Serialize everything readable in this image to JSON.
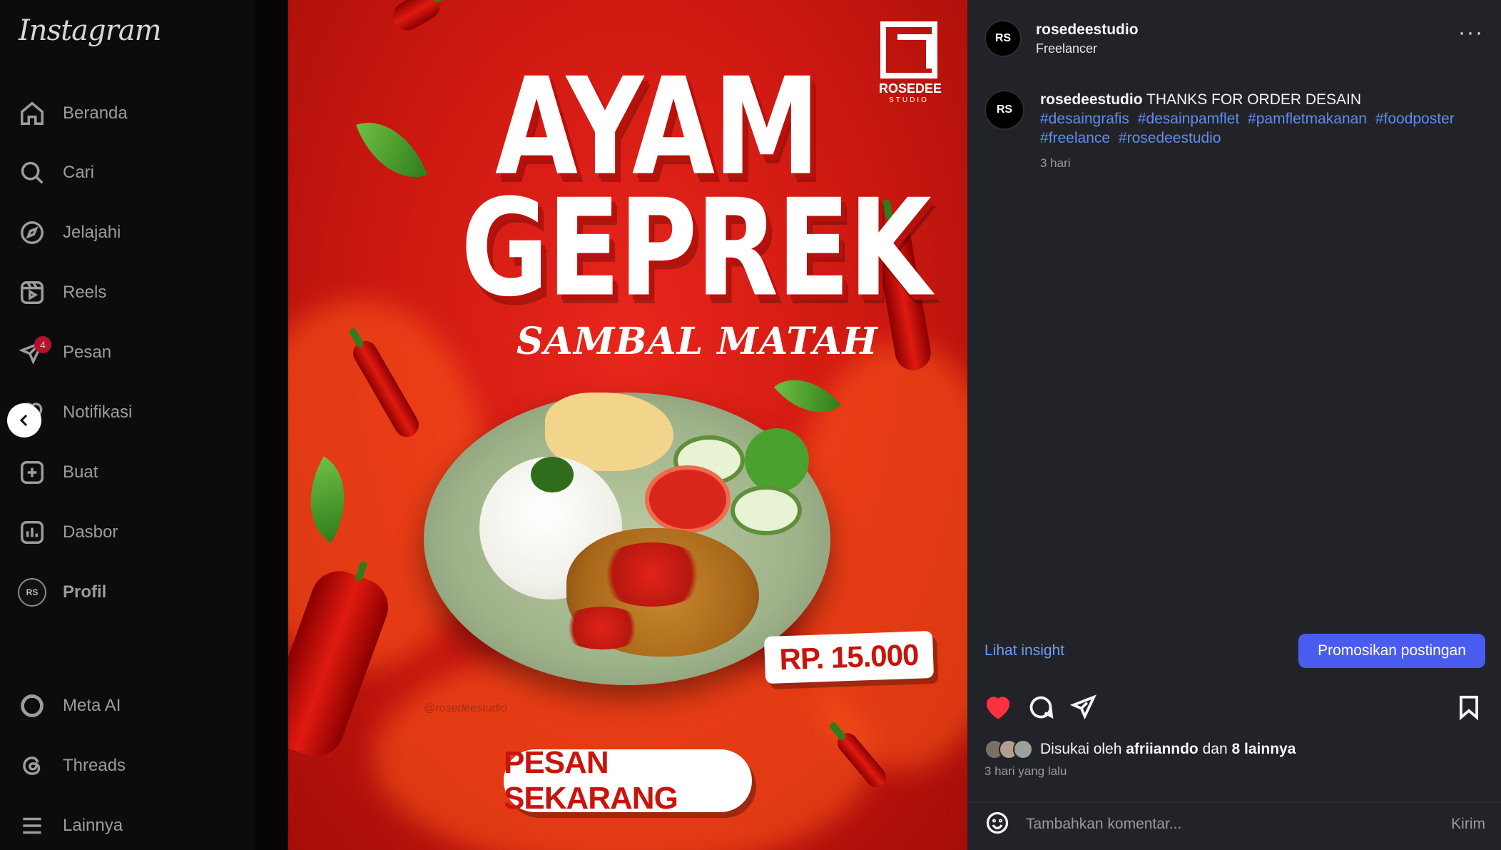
{
  "app": {
    "logo_text": "Instagram"
  },
  "sidebar": {
    "items": [
      {
        "label": "Beranda",
        "icon": "home-icon"
      },
      {
        "label": "Cari",
        "icon": "search-icon"
      },
      {
        "label": "Jelajahi",
        "icon": "compass-icon"
      },
      {
        "label": "Reels",
        "icon": "reels-icon"
      },
      {
        "label": "Pesan",
        "icon": "messenger-icon",
        "badge": "4"
      },
      {
        "label": "Notifikasi",
        "icon": "heart-icon"
      },
      {
        "label": "Buat",
        "icon": "plus-square-icon"
      },
      {
        "label": "Dasbor",
        "icon": "dashboard-icon"
      },
      {
        "label": "Profil",
        "icon": "profile-avatar-icon"
      }
    ],
    "bottom_items": [
      {
        "label": "Meta AI",
        "icon": "meta-ai-icon"
      },
      {
        "label": "Threads",
        "icon": "threads-icon"
      },
      {
        "label": "Lainnya",
        "icon": "hamburger-menu-icon"
      }
    ]
  },
  "poster": {
    "title_line1": "AYAM",
    "title_line2": "GEPREK",
    "subtitle": "SAMBAL MATAH",
    "brand_name": "ROSEDEE",
    "brand_sub": "STUDIO",
    "price": "RP. 15.000",
    "cta": "PESAN SEKARANG",
    "watermark": "@rosedeestudio",
    "colors": {
      "background": "#d11a12",
      "accent": "#c8140c"
    }
  },
  "post": {
    "username": "rosedeestudio",
    "subline": "Freelancer",
    "caption_text": "THANKS FOR ORDER DESAIN",
    "hashtags": [
      "#desaingrafis",
      "#desainpamflet",
      "#pamfletmakanan",
      "#foodposter",
      "#freelance",
      "#rosedeestudio"
    ],
    "caption_time": "3 hari",
    "insight_label": "Lihat insight",
    "promote_label": "Promosikan postingan",
    "likes_prefix": "Disukai oleh",
    "likes_user": "afriianndo",
    "likes_mid": "dan",
    "likes_others": "8 lainnya",
    "time_ago": "3 hari yang lalu",
    "comment_placeholder": "Tambahkan komentar...",
    "send_label": "Kirim",
    "colors": {
      "like": "#ff3040",
      "link": "#6e9cf0",
      "button": "#4a5cf0"
    }
  }
}
